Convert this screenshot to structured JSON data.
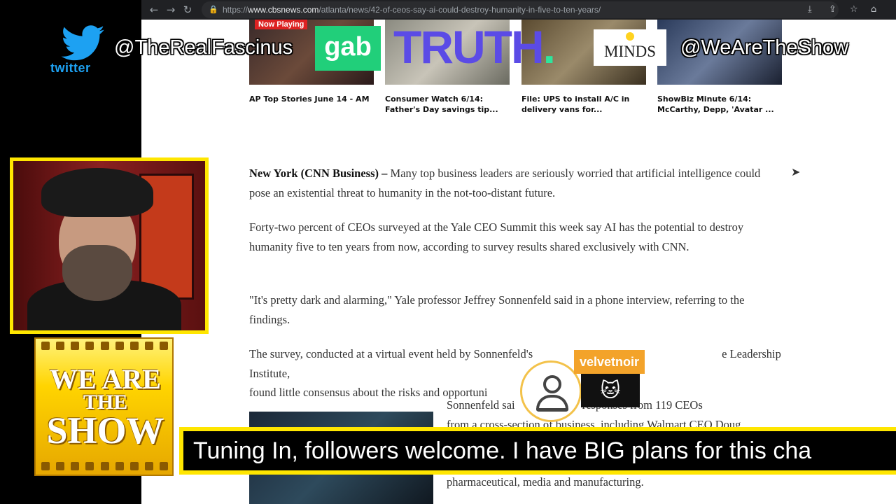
{
  "browser": {
    "url_prefix": "https://",
    "url_domain": "www.cbsnews.com",
    "url_path": "/atlanta/news/42-of-ceos-say-ai-could-destroy-humanity-in-five-to-ten-years/",
    "icons": [
      "back-arrow-icon",
      "forward-arrow-icon",
      "reload-icon",
      "lock-icon",
      "install-icon",
      "share-icon",
      "bookmark-star-icon",
      "home-icon"
    ]
  },
  "videos": [
    {
      "caption": "AP Top Stories June 14 - AM",
      "badge": "Now Playing"
    },
    {
      "caption": "Consumer Watch 6/14: Father's Day savings tip..."
    },
    {
      "caption": "File: UPS to install A/C in delivery vans for..."
    },
    {
      "caption": "ShowBiz Minute 6/14: McCarthy, Depp, 'Avatar ..."
    }
  ],
  "article": {
    "dateline": "New York (CNN Business)",
    "dash": " – ",
    "p1": "Many top business leaders are seriously worried that artificial intelligence could pose an existential threat to humanity in the not-too-distant future.",
    "p2": "Forty-two percent of CEOs surveyed at the Yale CEO Summit this week say AI has the potential to destroy humanity five to ten years from now, according to survey results shared exclusively with CNN.",
    "p3": "\"It's pretty dark and alarming,\" Yale professor Jeffrey Sonnenfeld said in a phone interview, referring to the findings.",
    "p4a": "The survey, conducted at a virtual event held by Sonnenfeld's",
    "p4b": "e Leadership Institute,",
    "p4c": "found little consensus about the risks and opportuni",
    "p5a": "Sonnenfeld sai",
    "p5b": "responses from 119 CEOs",
    "p5c": "from a cross-section of business, including Walmart CEO Doug",
    "p5d": "pharmaceutical, media and manufacturing."
  },
  "overlay": {
    "twitter_label": "twitter",
    "twitter_handle": "@TheRealFascinus",
    "gab": "gab",
    "truth": "TRUTH",
    "truth_dot": ".",
    "minds": "MINDS",
    "show_handle": "@WeAreTheShow",
    "show_logo": [
      "WE ARE",
      "THE",
      "SHOW"
    ],
    "ticker": "Tuning In, followers welcome.  I have BIG plans for this cha",
    "chat_user": "velvetnoir",
    "chat_emote": "🐱"
  },
  "colors": {
    "twitter_blue": "#1da1f2",
    "gab_green": "#21cf7a",
    "truth_purple": "#5b4be6",
    "ticker_yellow": "#ffe600",
    "chat_orange": "#f3a32a"
  }
}
